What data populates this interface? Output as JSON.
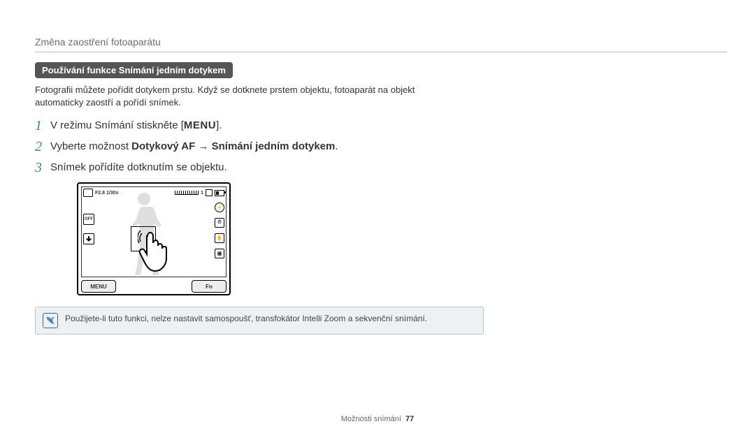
{
  "header": {
    "section_title": "Změna zaostření fotoaparátu"
  },
  "feature": {
    "pill": "Používání funkce Snímání jedním dotykem",
    "intro": "Fotografii můžete pořídit dotykem prstu. Když se dotknete prstem objektu, fotoaparát na objekt automaticky zaostří a pořídí snímek."
  },
  "steps": [
    {
      "num": "1",
      "pre": "V režimu Snímání stiskněte [",
      "bold": "",
      "menu_label": "MENU",
      "post": "]."
    },
    {
      "num": "2",
      "pre": "Vyberte možnost ",
      "bold": "Dotykový AF → Snímání jedním dotykem",
      "menu_label": "",
      "post": "."
    },
    {
      "num": "3",
      "pre": "Snímek pořídíte dotknutím se objektu.",
      "bold": "",
      "menu_label": "",
      "post": ""
    }
  ],
  "lcd": {
    "exposure": "F2.8 1/30s",
    "shots": "1",
    "menu_btn": "MENU",
    "fn_btn": "Fn",
    "left_icons": [
      "off-icon",
      "touch-icon"
    ],
    "right_icons": [
      "flash-icon",
      "timer-icon",
      "stabilize-icon",
      "burst-icon"
    ]
  },
  "note": {
    "text": "Použijete-li tuto funkci, nelze nastavit samospoušť, transfokátor Intelli Zoom a sekvenční snímání."
  },
  "footer": {
    "label": "Možnosti snímání",
    "page": "77"
  }
}
